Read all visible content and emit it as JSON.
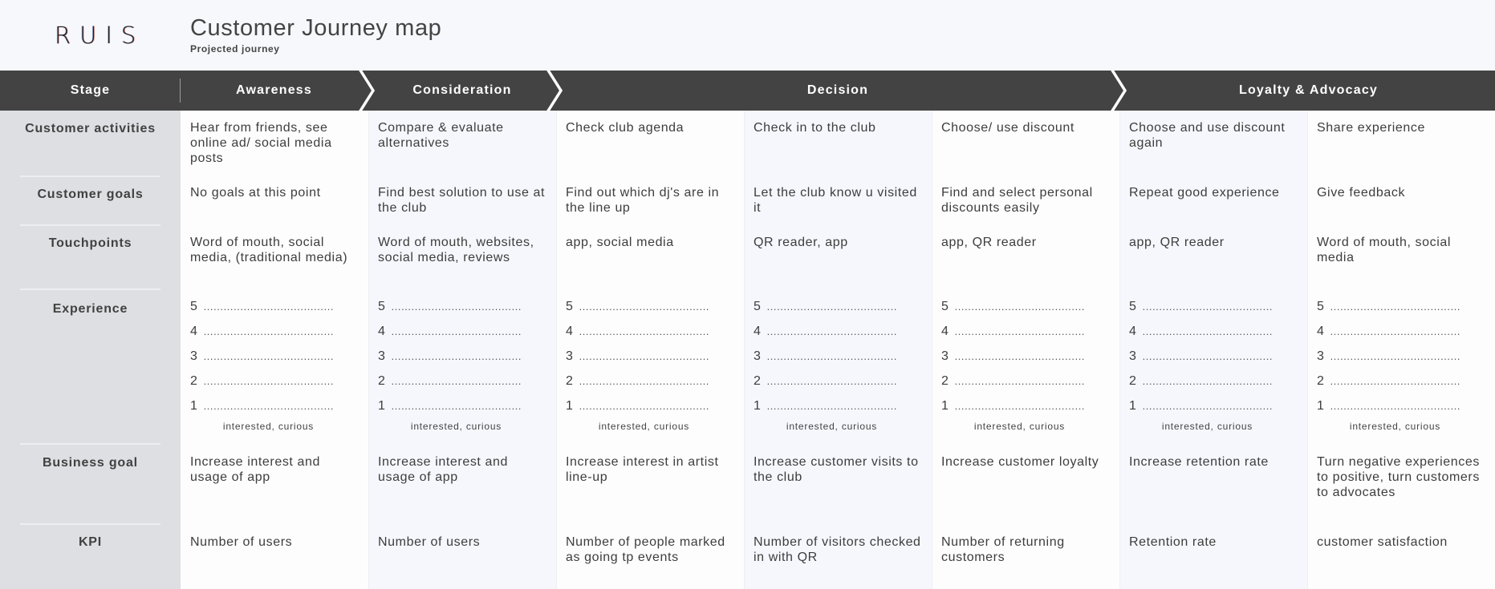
{
  "header": {
    "logo": "RUIS",
    "title": "Customer Journey map",
    "subtitle": "Projected journey"
  },
  "stages": {
    "label": "Stage",
    "items": [
      "Awareness",
      "Consideration",
      "Decision",
      "Loyalty & Advocacy"
    ]
  },
  "rows": {
    "labels": [
      "Customer activities",
      "Customer goals",
      "Touchpoints",
      "Experience",
      "Business goal",
      "KPI"
    ]
  },
  "columns": [
    {
      "stage": "Awareness",
      "activity": "Hear from friends, see online ad/ social media posts",
      "goal": "No goals at this point",
      "touchpoints": "Word of mouth, social media, (traditional media)",
      "experience_scale": [
        "5",
        "4",
        "3",
        "2",
        "1"
      ],
      "experience_caption": "interested, curious",
      "business_goal": "Increase interest and usage of app",
      "kpi": "Number of users"
    },
    {
      "stage": "Consideration",
      "activity": "Compare & evaluate alternatives",
      "goal": "Find best solution to use at the club",
      "touchpoints": "Word of mouth, websites, social media, reviews",
      "experience_scale": [
        "5",
        "4",
        "3",
        "2",
        "1"
      ],
      "experience_caption": "interested, curious",
      "business_goal": "Increase interest and usage of app",
      "kpi": "Number of users"
    },
    {
      "stage": "Decision",
      "activity": "Check club agenda",
      "goal": "Find out which dj's are in the line up",
      "touchpoints": "app, social media",
      "experience_scale": [
        "5",
        "4",
        "3",
        "2",
        "1"
      ],
      "experience_caption": "interested, curious",
      "business_goal": "Increase interest in artist line-up",
      "kpi": "Number of people marked as going tp events"
    },
    {
      "stage": "Decision",
      "activity": "Check in to the club",
      "goal": "Let the club know u visited it",
      "touchpoints": "QR reader, app",
      "experience_scale": [
        "5",
        "4",
        "3",
        "2",
        "1"
      ],
      "experience_caption": "interested, curious",
      "business_goal": "Increase customer visits to the club",
      "kpi": "Number of visitors checked in with QR"
    },
    {
      "stage": "Decision",
      "activity": "Choose/ use discount",
      "goal": "Find and select personal discounts easily",
      "touchpoints": "app, QR reader",
      "experience_scale": [
        "5",
        "4",
        "3",
        "2",
        "1"
      ],
      "experience_caption": "interested, curious",
      "business_goal": "Increase customer loyalty",
      "kpi": "Number of returning customers"
    },
    {
      "stage": "Loyalty & Advocacy",
      "activity": "Choose and use discount again",
      "goal": "Repeat good experience",
      "touchpoints": "app, QR reader",
      "experience_scale": [
        "5",
        "4",
        "3",
        "2",
        "1"
      ],
      "experience_caption": "interested, curious",
      "business_goal": "Increase retention rate",
      "kpi": "Retention rate"
    },
    {
      "stage": "Loyalty & Advocacy",
      "activity": "Share experience",
      "goal": "Give feedback",
      "touchpoints": "Word of mouth, social media",
      "experience_scale": [
        "5",
        "4",
        "3",
        "2",
        "1"
      ],
      "experience_caption": "interested, curious",
      "business_goal": "Turn negative experiences to positive, turn customers to advocates",
      "kpi": "customer satisfaction"
    }
  ],
  "experience_dots": "…………………………………",
  "colors": {
    "stage_bar": "#434343",
    "sidebar": "#dedfe3",
    "background": "#f7f8fc",
    "text": "#3f3f3f"
  }
}
